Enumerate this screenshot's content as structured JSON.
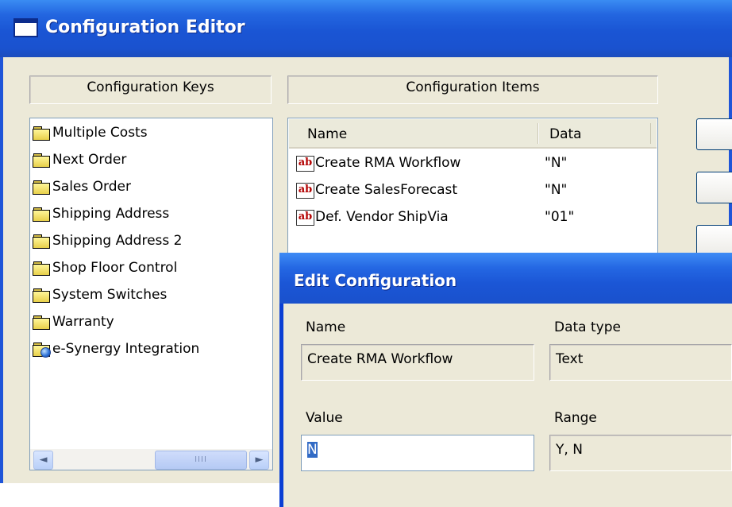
{
  "window": {
    "title": "Configuration Editor"
  },
  "headers": {
    "keys": "Configuration Keys",
    "items": "Configuration Items"
  },
  "keys": {
    "items": [
      {
        "label": "Multiple Costs",
        "icon": "folder-icon"
      },
      {
        "label": "Next Order",
        "icon": "folder-icon"
      },
      {
        "label": "Sales Order",
        "icon": "folder-icon"
      },
      {
        "label": "Shipping Address",
        "icon": "folder-icon"
      },
      {
        "label": "Shipping Address 2",
        "icon": "folder-icon"
      },
      {
        "label": "Shop Floor Control",
        "icon": "folder-icon"
      },
      {
        "label": "System Switches",
        "icon": "folder-icon"
      },
      {
        "label": "Warranty",
        "icon": "folder-icon"
      },
      {
        "label": "e-Synergy Integration",
        "icon": "folder-globe-icon"
      }
    ],
    "scrollbar": {
      "left": "◄",
      "right": "►",
      "thumb_grip": "IIII"
    }
  },
  "items": {
    "columns": [
      "Name",
      "Data"
    ],
    "rows": [
      {
        "icon_text": "ab",
        "name": "Create RMA Workflow",
        "data": "\"N\""
      },
      {
        "icon_text": "ab",
        "name": "Create SalesForecast",
        "data": "\"N\""
      },
      {
        "icon_text": "ab",
        "name": "Def. Vendor ShipVia",
        "data": "\"01\""
      }
    ]
  },
  "dialog": {
    "title": "Edit Configuration",
    "name_label": "Name",
    "name_value": "Create RMA Workflow",
    "datatype_label": "Data type",
    "datatype_value": "Text",
    "value_label": "Value",
    "value_value": "N",
    "range_label": "Range",
    "range_value": "Y, N"
  },
  "colors": {
    "titlebar": "#1a55d4",
    "client": "#ece9d8",
    "selection": "#316ac5"
  }
}
